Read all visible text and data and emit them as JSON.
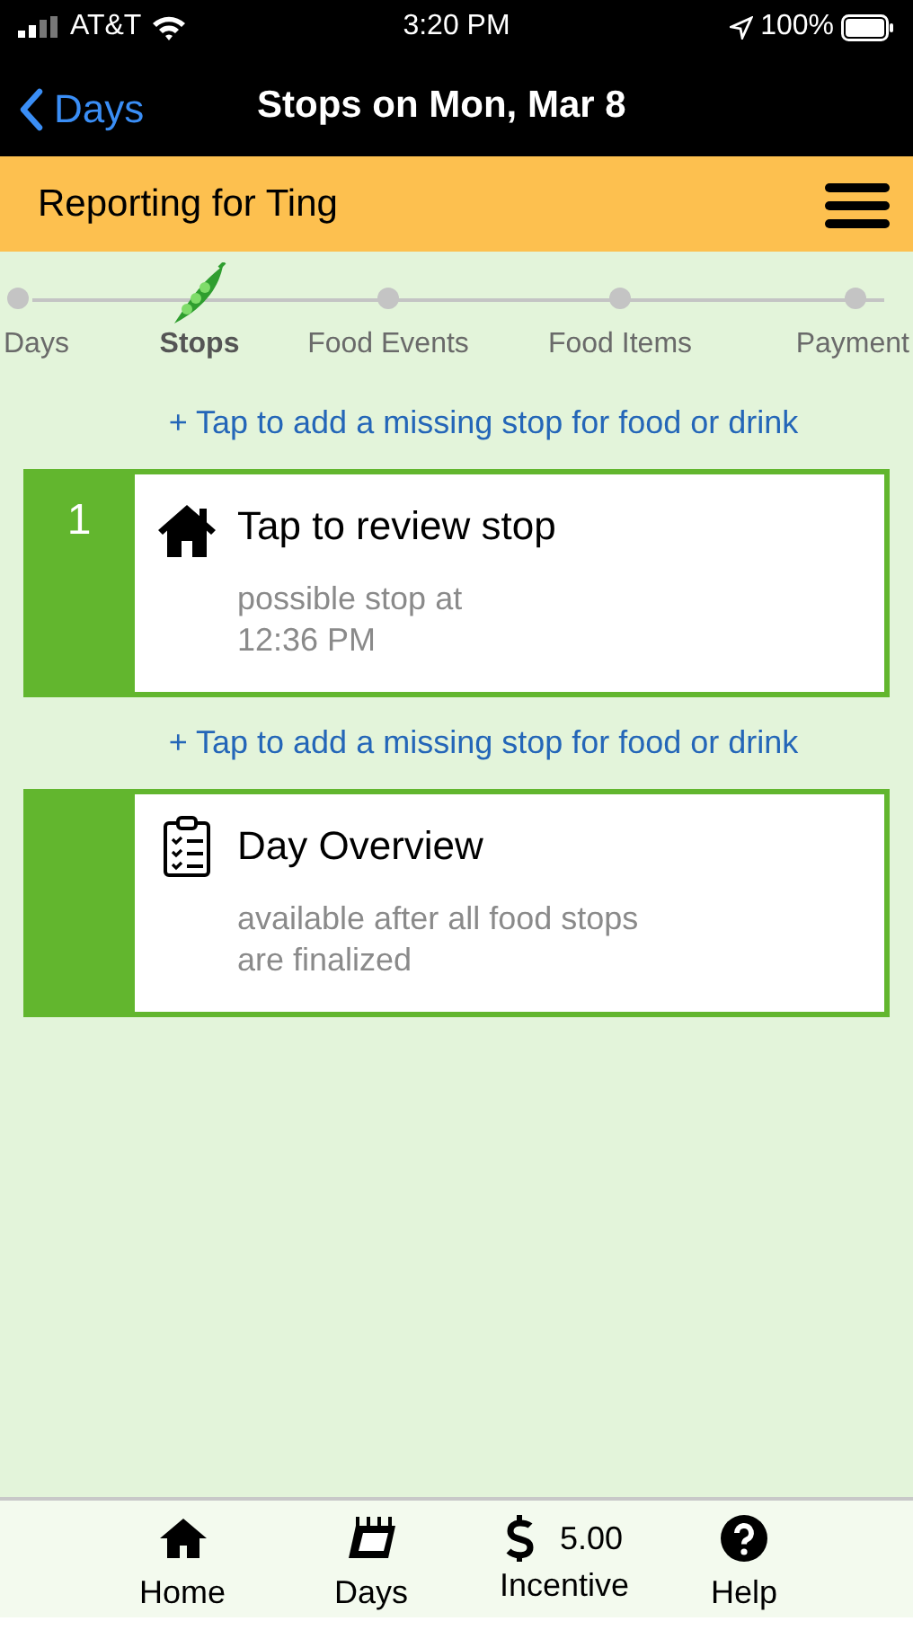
{
  "status_bar": {
    "carrier": "AT&T",
    "time": "3:20 PM",
    "battery": "100%"
  },
  "nav": {
    "back": "Days",
    "title": "Stops on Mon, Mar 8"
  },
  "header": {
    "title": "Reporting for Ting"
  },
  "steps": [
    {
      "label": "Days",
      "selected": false
    },
    {
      "label": "Stops",
      "selected": true
    },
    {
      "label": "Food Events",
      "selected": false
    },
    {
      "label": "Food Items",
      "selected": false
    },
    {
      "label": "Payment",
      "selected": false
    }
  ],
  "list": [
    {
      "kind": "add_link",
      "text": "+ Tap to add a missing stop for food or drink"
    },
    {
      "kind": "stop",
      "number": "1",
      "title": "Tap to review stop",
      "subtitle": [
        "possible stop at",
        "12:36 PM"
      ]
    },
    {
      "kind": "add_link",
      "text": "+ Tap to add a missing stop for food or drink"
    },
    {
      "kind": "overview",
      "title": "Day Overview",
      "subtitle": [
        "available after all food stops",
        "are finalized"
      ]
    }
  ],
  "tab_bar": [
    {
      "kind": "home",
      "label": "Home"
    },
    {
      "kind": "days",
      "label": "Days"
    },
    {
      "kind": "incentive",
      "label": "Incentive",
      "amount": "5.00"
    },
    {
      "kind": "help",
      "label": "Help"
    }
  ]
}
